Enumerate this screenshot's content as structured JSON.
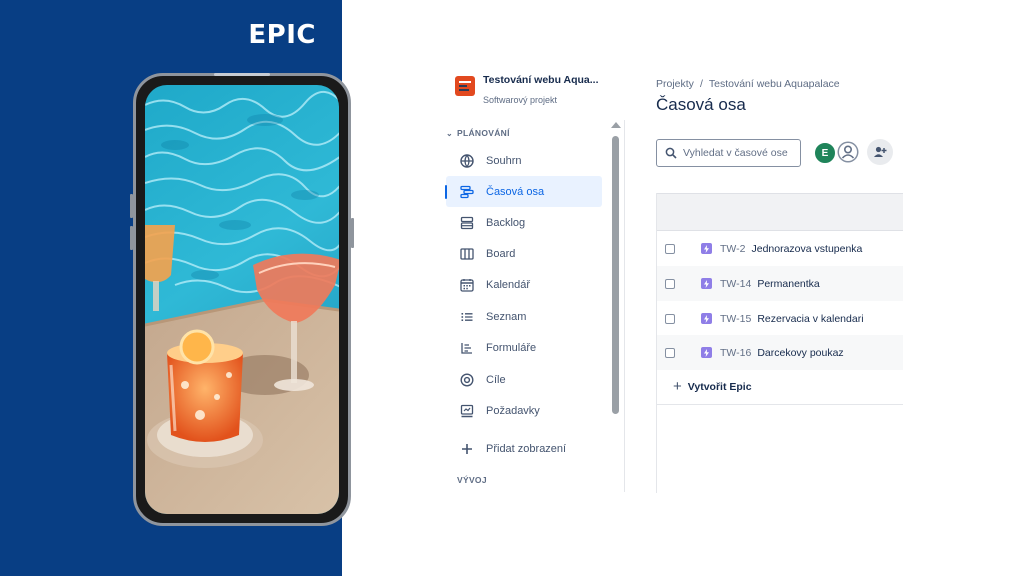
{
  "banner": {
    "title": "EPIC"
  },
  "project": {
    "name": "Testování webu Aqua...",
    "type": "Softwarový projekt"
  },
  "sidebar": {
    "section_planning": "PLÁNOVÁNÍ",
    "section_development": "VÝVOJ",
    "items": [
      {
        "label": "Souhrn",
        "icon": "globe-icon"
      },
      {
        "label": "Časová osa",
        "icon": "timeline-icon",
        "selected": true
      },
      {
        "label": "Backlog",
        "icon": "backlog-icon"
      },
      {
        "label": "Board",
        "icon": "board-icon"
      },
      {
        "label": "Kalendář",
        "icon": "calendar-icon"
      },
      {
        "label": "Seznam",
        "icon": "list-icon"
      },
      {
        "label": "Formuláře",
        "icon": "forms-icon"
      },
      {
        "label": "Cíle",
        "icon": "goals-icon"
      },
      {
        "label": "Požadavky",
        "icon": "requests-icon"
      },
      {
        "label": "Přidat zobrazení",
        "icon": "plus-icon"
      }
    ]
  },
  "breadcrumb": {
    "root": "Projekty",
    "separator": "/",
    "project": "Testování webu Aquapalace"
  },
  "page": {
    "title": "Časová osa"
  },
  "search": {
    "placeholder": "Vyhledat v časové ose"
  },
  "avatars": {
    "user_initial": "E",
    "user_color": "#1f845a"
  },
  "epics": [
    {
      "key": "TW-2",
      "summary": "Jednorazova vstupenka"
    },
    {
      "key": "TW-14",
      "summary": "Permanentka"
    },
    {
      "key": "TW-15",
      "summary": "Rezervacia v kalendari"
    },
    {
      "key": "TW-16",
      "summary": "Darcekovy poukaz"
    }
  ],
  "create_epic": {
    "label": "Vytvořit Epic"
  },
  "colors": {
    "banner_blue": "#083e84",
    "selected_blue": "#0c66e4",
    "epic_purple": "#8f7ee7"
  }
}
